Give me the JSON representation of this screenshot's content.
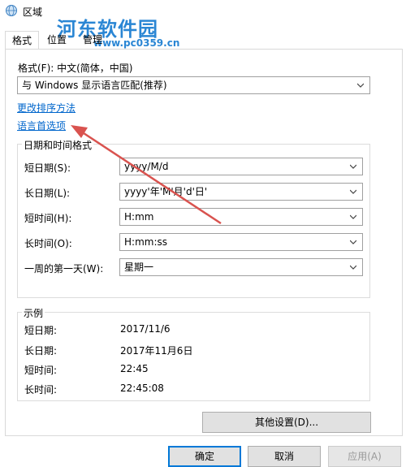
{
  "window": {
    "title": "区域"
  },
  "watermark": {
    "name": "河东软件园",
    "url": "www.pc0359.cn"
  },
  "tabs": [
    {
      "label": "格式"
    },
    {
      "label": "位置"
    },
    {
      "label": "管理"
    }
  ],
  "format": {
    "label": "格式(F): 中文(简体，中国)",
    "selected": "与 Windows 显示语言匹配(推荐)"
  },
  "links": {
    "sort": "更改排序方法",
    "language": "语言首选项"
  },
  "datetime": {
    "group_title": "日期和时间格式",
    "rows": [
      {
        "label": "短日期(S):",
        "value": "yyyy/M/d"
      },
      {
        "label": "长日期(L):",
        "value": "yyyy'年'M'月'd'日'"
      },
      {
        "label": "短时间(H):",
        "value": "H:mm"
      },
      {
        "label": "长时间(O):",
        "value": "H:mm:ss"
      },
      {
        "label": "一周的第一天(W):",
        "value": "星期一"
      }
    ]
  },
  "examples": {
    "group_title": "示例",
    "rows": [
      {
        "label": "短日期:",
        "value": "2017/11/6"
      },
      {
        "label": "长日期:",
        "value": "2017年11月6日"
      },
      {
        "label": "短时间:",
        "value": "22:45"
      },
      {
        "label": "长时间:",
        "value": "22:45:08"
      }
    ]
  },
  "buttons": {
    "other_settings": "其他设置(D)...",
    "ok": "确定",
    "cancel": "取消",
    "apply": "应用(A)"
  },
  "colors": {
    "accent": "#0078d7",
    "link": "#0066cc",
    "annotation_arrow": "#d9534f",
    "watermark": "#2a86d4"
  }
}
